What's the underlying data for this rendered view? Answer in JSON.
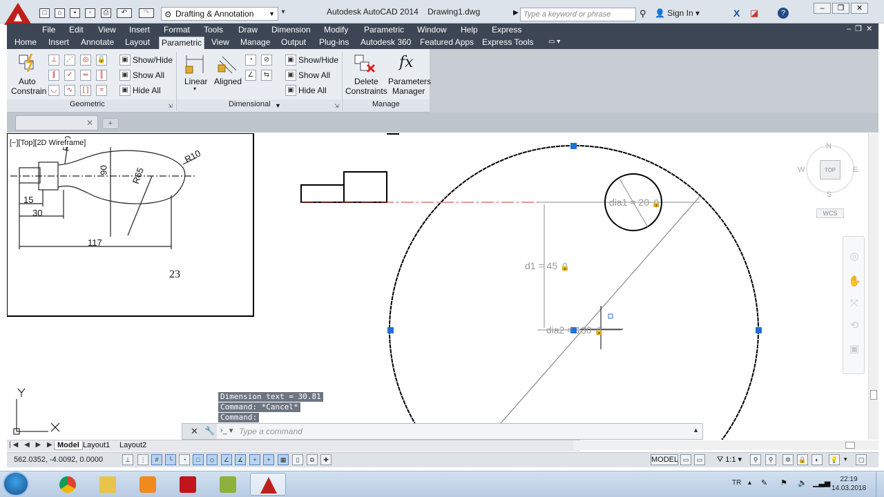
{
  "title_bar": {
    "workspace": "Drafting & Annotation",
    "app_title": "Autodesk AutoCAD 2014",
    "document_title": "Drawing1.dwg",
    "search_placeholder": "Type a keyword or phrase",
    "sign_in": "Sign In"
  },
  "menubar": {
    "items": [
      "File",
      "Edit",
      "View",
      "Insert",
      "Format",
      "Tools",
      "Draw",
      "Dimension",
      "Modify",
      "Parametric",
      "Window",
      "Help",
      "Express"
    ]
  },
  "ribbon_tabs": {
    "items": [
      "Home",
      "Insert",
      "Annotate",
      "Layout",
      "Parametric",
      "View",
      "Manage",
      "Output",
      "Plug-ins",
      "Autodesk 360",
      "Featured Apps",
      "Express Tools"
    ],
    "active": "Parametric"
  },
  "ribbon": {
    "geometric": {
      "title": "Geometric",
      "auto_constrain_line1": "Auto",
      "auto_constrain_line2": "Constrain",
      "show_hide": "Show/Hide",
      "show_all": "Show All",
      "hide_all": "Hide All"
    },
    "dimensional": {
      "title": "Dimensional",
      "linear": "Linear",
      "aligned": "Aligned",
      "show_hide": "Show/Hide",
      "show_all": "Show All",
      "hide_all": "Hide All"
    },
    "manage": {
      "title": "Manage",
      "delete_line1": "Delete",
      "delete_line2": "Constraints",
      "params_line1": "Parameters",
      "params_line2": "Manager"
    }
  },
  "viewport": {
    "label": "[−][Top][2D Wireframe]"
  },
  "drawing": {
    "ref_dims": {
      "r10a": "R10",
      "r10b": "R10",
      "d90": "90",
      "r65": "R65",
      "d15": "15",
      "d30": "30",
      "d117": "117",
      "sheet_no": "23"
    },
    "constraints": {
      "dia1": "dia1 = 20",
      "d1": "d1 = 45",
      "dia2": "dia2 = 130"
    }
  },
  "viewcube": {
    "n": "N",
    "s": "S",
    "e": "E",
    "w": "W",
    "top": "TOP",
    "wcs": "WCS"
  },
  "command": {
    "history": [
      "Dimension text = 30.81",
      "Command: *Cancel*",
      "Command:"
    ],
    "placeholder": "Type a command"
  },
  "layout_tabs": [
    "Model",
    "Layout1",
    "Layout2"
  ],
  "status": {
    "coords": "562.0352, -4.0092, 0.0000",
    "model": "MODEL",
    "scale": "1:1"
  },
  "taskbar": {
    "lang": "TR",
    "time": "22:19",
    "date": "14.03.2018"
  },
  "colors": {
    "menubar_bg": "#3d4654",
    "ribbon_bg": "#e9edf2",
    "grip_blue": "#1f6fd6",
    "centerline_red": "#c0392b",
    "constraint_gray": "#999999"
  }
}
